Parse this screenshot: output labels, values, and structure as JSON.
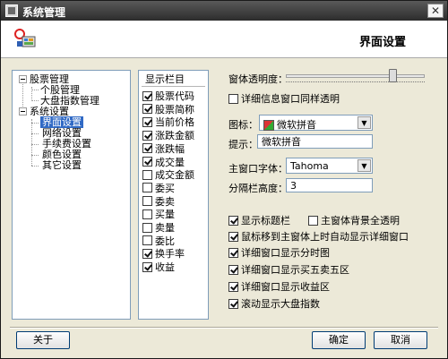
{
  "window": {
    "title": "系统管理",
    "close_glyph": "✕"
  },
  "header": {
    "page_title": "界面设置",
    "icon": "system-settings-icon"
  },
  "tree": {
    "nodes": [
      {
        "label": "股票管理",
        "level": 0,
        "expanded": true
      },
      {
        "label": "个股管理",
        "level": 1
      },
      {
        "label": "大盘指数管理",
        "level": 1
      },
      {
        "label": "系统设置",
        "level": 0,
        "expanded": true
      },
      {
        "label": "界面设置",
        "level": 1,
        "selected": true
      },
      {
        "label": "网络设置",
        "level": 1
      },
      {
        "label": "手续费设置",
        "level": 1
      },
      {
        "label": "颜色设置",
        "level": 1
      },
      {
        "label": "其它设置",
        "level": 1
      }
    ]
  },
  "columns": {
    "header": "显示栏目",
    "items": [
      {
        "label": "股票代码",
        "checked": true
      },
      {
        "label": "股票简称",
        "checked": true
      },
      {
        "label": "当前价格",
        "checked": true
      },
      {
        "label": "涨跌金额",
        "checked": true
      },
      {
        "label": "涨跌幅",
        "checked": true
      },
      {
        "label": "成交量",
        "checked": true
      },
      {
        "label": "成交金额",
        "checked": false
      },
      {
        "label": "委买",
        "checked": false
      },
      {
        "label": "委卖",
        "checked": false
      },
      {
        "label": "买量",
        "checked": false
      },
      {
        "label": "卖量",
        "checked": false
      },
      {
        "label": "委比",
        "checked": false
      },
      {
        "label": "换手率",
        "checked": true
      },
      {
        "label": "收益",
        "checked": true
      }
    ]
  },
  "settings": {
    "transparency_label": "窗体透明度：",
    "transparency_level": 0.77,
    "detail_transparent_label": "详细信息窗口同样透明",
    "detail_transparent_checked": false,
    "icon_label": "图标：",
    "icon_value": "微软拼音",
    "hint_label": "提示：",
    "hint_value": "微软拼音",
    "font_label": "主窗口字体：",
    "font_value": "Tahoma",
    "divider_height_label": "分隔栏高度：",
    "divider_height_value": "3",
    "options": [
      {
        "label": "显示标题栏",
        "checked": true
      },
      {
        "label": "主窗体背景全透明",
        "checked": false
      },
      {
        "label": "鼠标移到主窗体上时自动显示详细窗口",
        "checked": true
      },
      {
        "label": "详细窗口显示分时图",
        "checked": true
      },
      {
        "label": "详细窗口显示买五卖五区",
        "checked": true
      },
      {
        "label": "详细窗口显示收益区",
        "checked": true
      },
      {
        "label": "滚动显示大盘指数",
        "checked": true
      }
    ]
  },
  "buttons": {
    "about": "关于",
    "ok": "确定",
    "cancel": "取消"
  }
}
